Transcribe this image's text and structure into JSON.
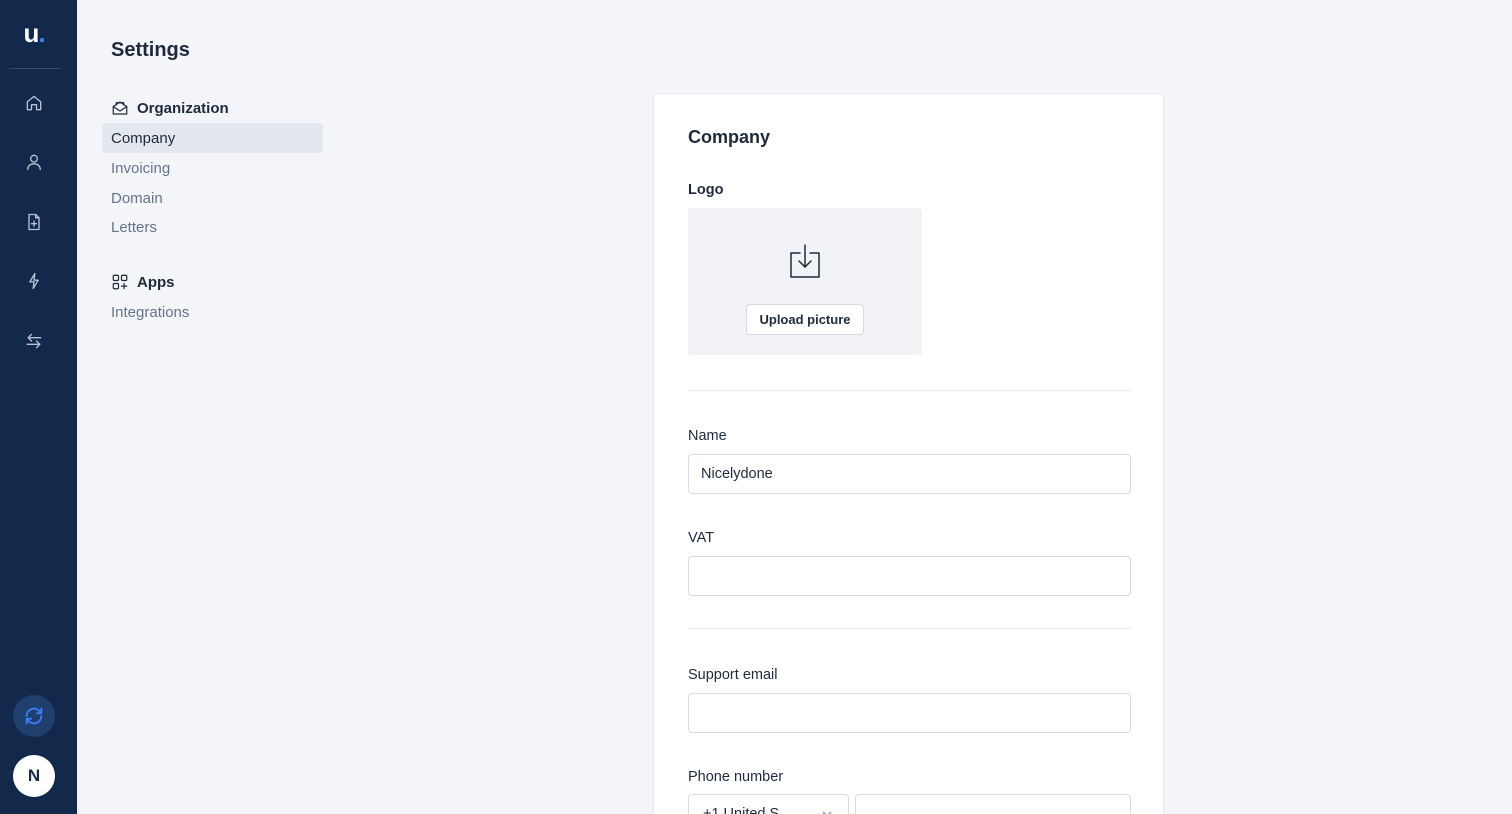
{
  "rail": {
    "logo_letter": "u",
    "logo_dot": ".",
    "icons": [
      "home-icon",
      "user-icon",
      "document-icon",
      "lightning-icon",
      "transfer-icon"
    ],
    "avatar_initial": "N",
    "accent_color": "#3b82f6",
    "background_color": "#13294b"
  },
  "settings": {
    "title": "Settings",
    "sections": [
      {
        "label": "Organization",
        "icon": "envelope-open-icon",
        "items": [
          "Company",
          "Invoicing",
          "Domain",
          "Letters"
        ]
      },
      {
        "label": "Apps",
        "icon": "apps-grid-icon",
        "items": [
          "Integrations"
        ]
      }
    ],
    "active_item": "Company"
  },
  "company": {
    "title": "Company",
    "logo_label": "Logo",
    "upload_button": "Upload picture",
    "name_label": "Name",
    "name_value": "Nicelydone",
    "vat_label": "VAT",
    "vat_value": "",
    "support_email_label": "Support email",
    "support_email_value": "",
    "phone_label": "Phone number",
    "phone_country": "+1 United S",
    "phone_value": ""
  }
}
